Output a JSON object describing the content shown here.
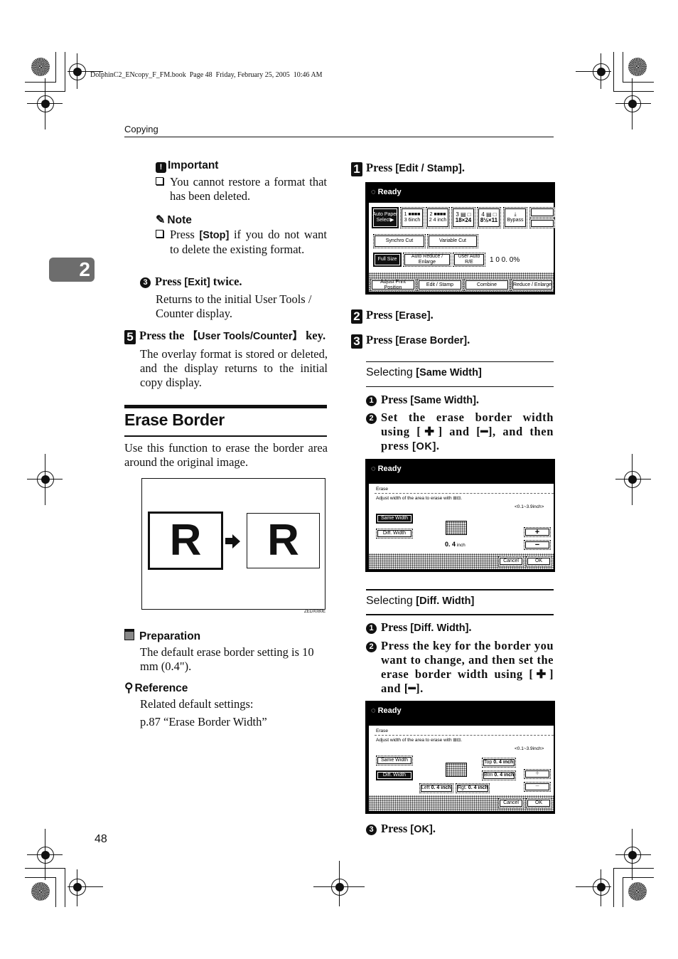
{
  "file_header": "DolphinC2_ENcopy_F_FM.book  Page 48  Friday, February 25, 2005  10:46 AM",
  "running_head": "Copying",
  "chapter_tab": "2",
  "page_number": "48",
  "left": {
    "important": {
      "title": "Important",
      "items": [
        "You cannot restore a format that has been deleted."
      ]
    },
    "note": {
      "title": "Note",
      "items": [
        {
          "pre": "Press ",
          "key": "[Stop]",
          "post": " if you do not want to delete the existing format."
        }
      ]
    },
    "substep3": {
      "num": "3",
      "pre": "Press ",
      "key": "[Exit]",
      "post": " twice.",
      "desc": "Returns to the initial User Tools / Counter display."
    },
    "step5": {
      "num": "5",
      "pre": "Press the ",
      "key": "【User Tools/Counter】",
      "post": " key.",
      "desc": "The overlay format is stored or deleted, and the display returns to the initial copy display."
    },
    "section_title": "Erase Border",
    "section_intro": "Use this function to erase the border area around the original image.",
    "figure": {
      "letter": "R",
      "code": "ZEDX080E"
    },
    "preparation": {
      "title": "Preparation",
      "text": "The default erase border setting is 10 mm (0.4\")."
    },
    "reference": {
      "title": "Reference",
      "text1": "Related default settings:",
      "text2": "p.87 “Erase Border Width”"
    }
  },
  "right": {
    "step1": {
      "num": "1",
      "pre": "Press ",
      "key": "[Edit / Stamp]",
      "post": "."
    },
    "screen1": {
      "status": "Ready",
      "trays": [
        {
          "l1": "Auto Paper",
          "l2": "Select▶",
          "selected": true
        },
        {
          "l1": "1 ■■■■",
          "l2": "3 6inch"
        },
        {
          "l1": "2 ■■■■",
          "l2": "2 4 inch"
        },
        {
          "l1": "3 ▤ □",
          "l2": "18×24"
        },
        {
          "l1": "4 ▤ □",
          "l2": "8½×11"
        },
        {
          "l1": "⤓",
          "l2": "Bypass"
        }
      ],
      "cut_buttons": [
        "Synchro Cut",
        "Variable Cut"
      ],
      "ratio_buttons": [
        "Full Size",
        "Auto Reduce / Enlarge",
        "User Auto R/E"
      ],
      "ratio_value": "1 0 0. 0%",
      "tabs": [
        "Adjust Print Position",
        "Edit / Stamp",
        "Combine",
        "Reduce / Enlarge"
      ]
    },
    "step2": {
      "num": "2",
      "pre": "Press ",
      "key": "[Erase]",
      "post": "."
    },
    "step3": {
      "num": "3",
      "pre": "Press ",
      "key": "[Erase Border]",
      "post": "."
    },
    "same_width": {
      "heading_pre": "Selecting ",
      "heading_key": "[Same Width]",
      "s1": {
        "num": "1",
        "pre": "Press ",
        "key": "[Same Width]",
        "post": "."
      },
      "s2": {
        "num": "2",
        "text_a": "Set the erase border width using [",
        "plus": "✚",
        "text_b": "] and [",
        "minus": "━",
        "text_c": "], and then press ",
        "key": "[OK]",
        "post": "."
      }
    },
    "screen2": {
      "status": "Ready",
      "section": "Erase",
      "instruction": "Adjust width of the area to erase with ⊞⊟.",
      "range": "<0.1~3.9inch>",
      "same_width": "Same Width",
      "diff_width": "Diff. Width",
      "value": "0. 4",
      "unit": "inch",
      "plus": "+",
      "minus": "−",
      "cancel": "Cancel",
      "ok": "OK"
    },
    "diff_width": {
      "heading_pre": "Selecting ",
      "heading_key": "[Diff. Width]",
      "s1": {
        "num": "1",
        "pre": "Press ",
        "key": "[Diff. Width]",
        "post": "."
      },
      "s2": {
        "num": "2",
        "text_a": "Press the key for the border you want to change, and then set the erase border width using [",
        "plus": "✚",
        "text_b": "] and [",
        "minus": "━",
        "text_c": "]."
      },
      "s3": {
        "num": "3",
        "pre": "Press ",
        "key": "[OK]",
        "post": "."
      }
    },
    "screen3": {
      "status": "Ready",
      "section": "Erase",
      "instruction": "Adjust width of the area to erase with ⊞⊟.",
      "range": "<0.1~3.9inch>",
      "same_width": "Same Width",
      "diff_width": "Diff. Width",
      "top_label": "Top",
      "top_value": "0. 4 inch",
      "btm_label": "Btm",
      "btm_value": "0. 4 inch",
      "left_label": "Left",
      "left_value": "0. 4 inch",
      "rgt_label": "Rgt.",
      "rgt_value": "0. 4 inch",
      "plus": "+",
      "minus": "−",
      "cancel": "Cancel",
      "ok": "OK"
    }
  }
}
